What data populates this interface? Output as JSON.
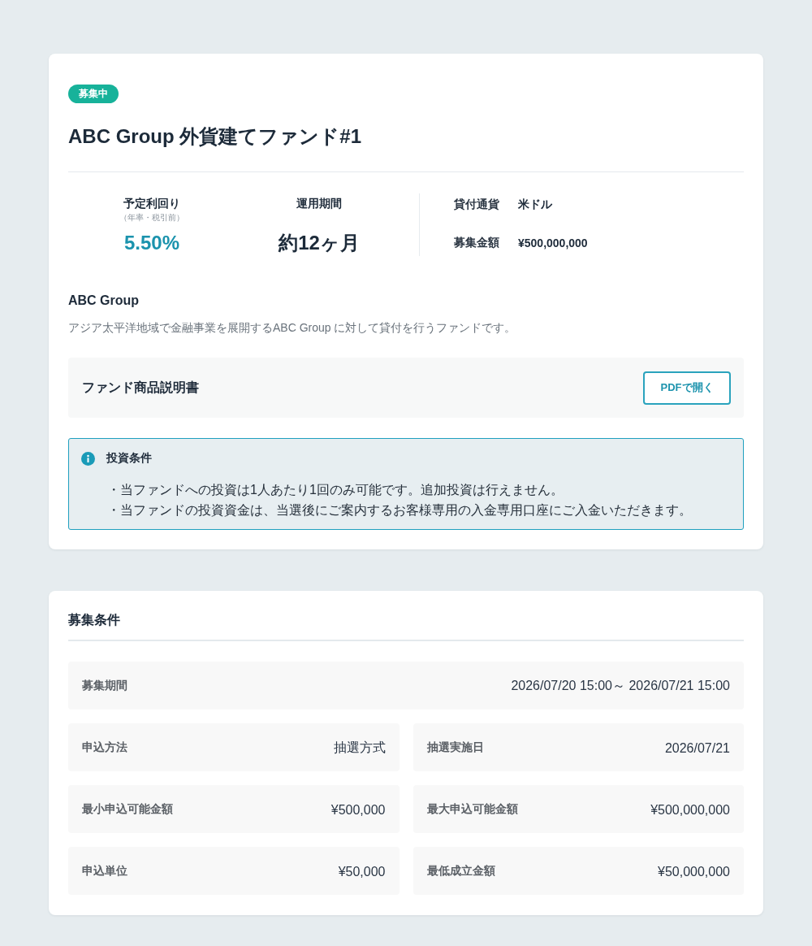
{
  "fund_card": {
    "status_badge": "募集中",
    "title": "ABC Group 外貨建てファンド#1",
    "highlights": [
      {
        "kind": "rate",
        "label": "予定利回り",
        "note": "（年率・税引前）",
        "value": "5.50%"
      },
      {
        "kind": "period",
        "label": "運用期間",
        "value": "約12ヶ月"
      }
    ],
    "details": [
      {
        "label": "貸付通貨",
        "value": "米ドル"
      },
      {
        "label": "募集金額",
        "value": "¥500,000,000"
      }
    ],
    "borrower": {
      "name": "ABC Group",
      "description": "アジア太平洋地域で金融事業を展開するABC Group に対して貸付を行うファンドです。"
    },
    "document": {
      "title": "ファンド商品説明書",
      "button": "PDFで開く"
    },
    "notice": {
      "title": "投資条件",
      "items": [
        "・当ファンドへの投資は1人あたり1回のみ可能です。追加投資は行えません。",
        "・当ファンドの投資資金は、当選後にご案内するお客様専用の入金専用口座にご入金いただきます。"
      ]
    }
  },
  "conditions_card": {
    "title": "募集条件",
    "items": [
      {
        "kind": "wide",
        "label": "募集期間",
        "value": "2026/07/20 15:00～ 2026/07/21 15:00"
      },
      {
        "kind": "half",
        "label": "申込方法",
        "value": "抽選方式"
      },
      {
        "kind": "half",
        "label": "抽選実施日",
        "value": "2026/07/21"
      },
      {
        "kind": "half",
        "label": "最小申込可能金額",
        "value": "¥500,000"
      },
      {
        "kind": "half",
        "label": "最大申込可能金額",
        "value": "¥500,000,000"
      },
      {
        "kind": "half",
        "label": "申込単位",
        "value": "¥50,000"
      },
      {
        "kind": "half",
        "label": "最低成立金額",
        "value": "¥50,000,000"
      }
    ]
  }
}
